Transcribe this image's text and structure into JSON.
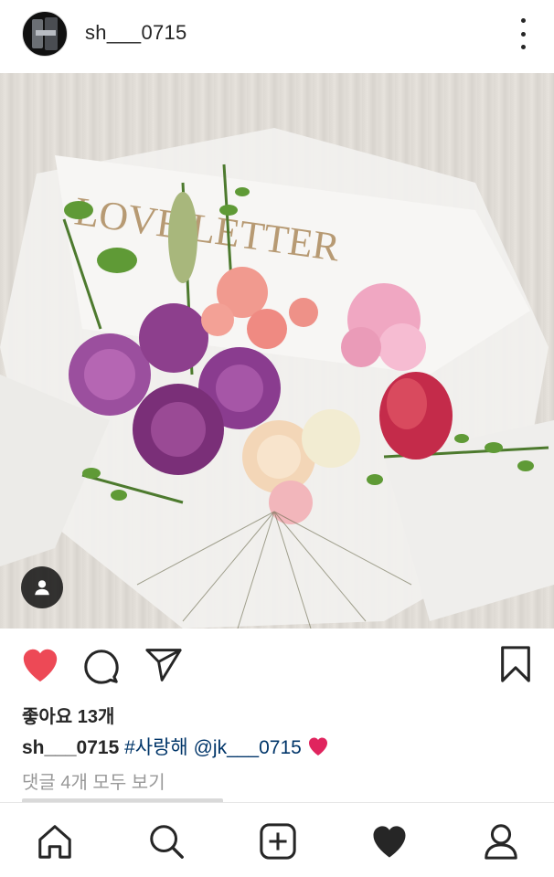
{
  "post": {
    "author": "sh___0715",
    "likes_label": "좋아요 13개",
    "caption_user": "sh___0715",
    "caption_hashtag": "#사랑해",
    "caption_mention": "@jk___0715",
    "caption_emoji": "❤️",
    "view_comments_label": "댓글 4개 모두 보기",
    "photo_wrapper_text": "LOVE LETTER",
    "liked": true
  },
  "icons": {
    "more": "more-vertical-icon",
    "like": "heart-filled-icon",
    "comment": "comment-icon",
    "share": "send-icon",
    "save": "bookmark-icon",
    "tag": "user-tag-icon"
  },
  "bottom_nav": [
    {
      "name": "home",
      "icon": "home-icon"
    },
    {
      "name": "search",
      "icon": "search-icon"
    },
    {
      "name": "new-post",
      "icon": "plus-square-icon"
    },
    {
      "name": "activity",
      "icon": "heart-filled-icon"
    },
    {
      "name": "profile",
      "icon": "user-icon"
    }
  ],
  "colors": {
    "like_red": "#ed4956",
    "text": "#262626",
    "link": "#003569",
    "muted": "#999999"
  }
}
